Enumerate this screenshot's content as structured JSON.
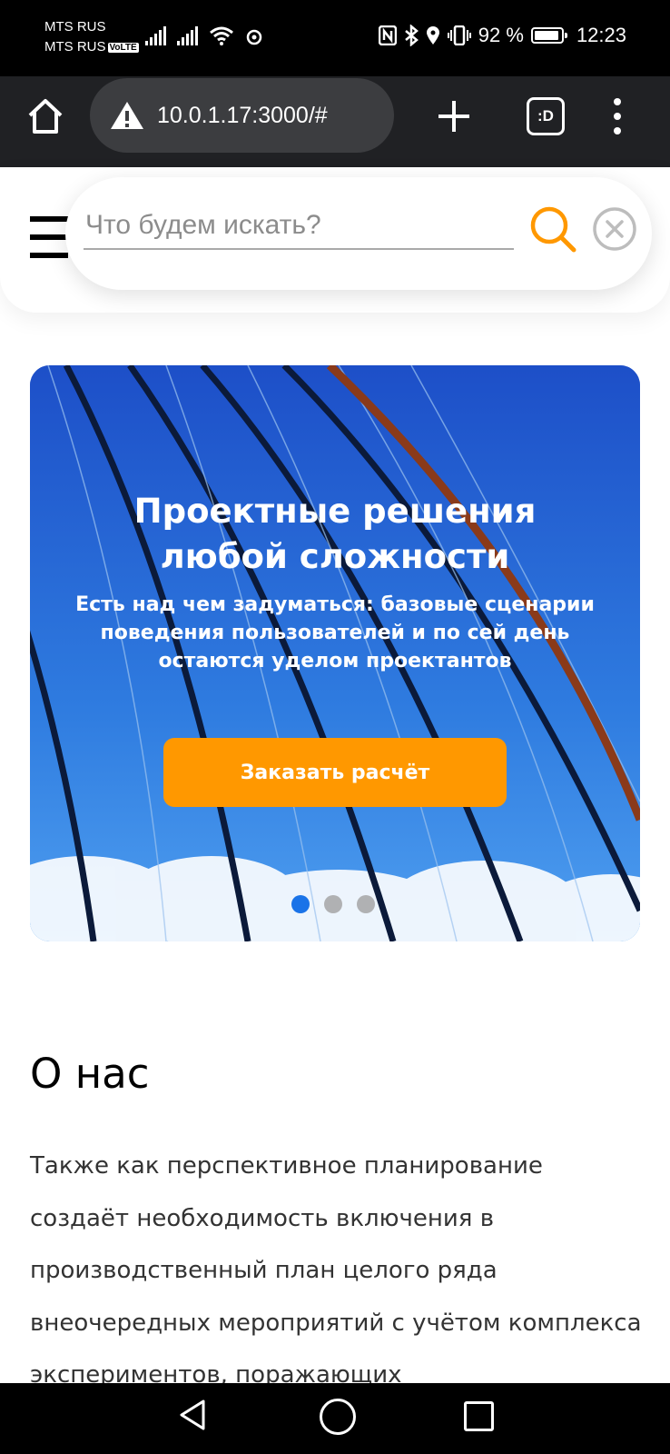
{
  "status_bar": {
    "carrier1": "MTS RUS",
    "carrier2": "MTS RUS",
    "volte": "VoLTE",
    "battery_text": "92 %",
    "battery_level": 0.92,
    "time": "12:23"
  },
  "browser": {
    "url": "10.0.1.17:3000/#",
    "tabs_label": ":D"
  },
  "search": {
    "placeholder": "Что будем искать?"
  },
  "banner": {
    "title": "Проектные решения\nлюбой сложности",
    "subtitle": "Есть над чем задуматься: базовые сценарии\nповедения пользователей и по сей день\nостаются уделом проектантов",
    "cta_label": "Заказать расчёт",
    "active_slide": 1,
    "slide_count": 3
  },
  "about": {
    "title": "О нас",
    "text": "Также как перспективное планирование создаёт необходимость включения в производственный план целого ряда внеочередных мероприятий с учётом комплекса экспериментов, поражающих"
  },
  "colors": {
    "accent": "#ff9800",
    "active_dot": "#1a73e8"
  }
}
